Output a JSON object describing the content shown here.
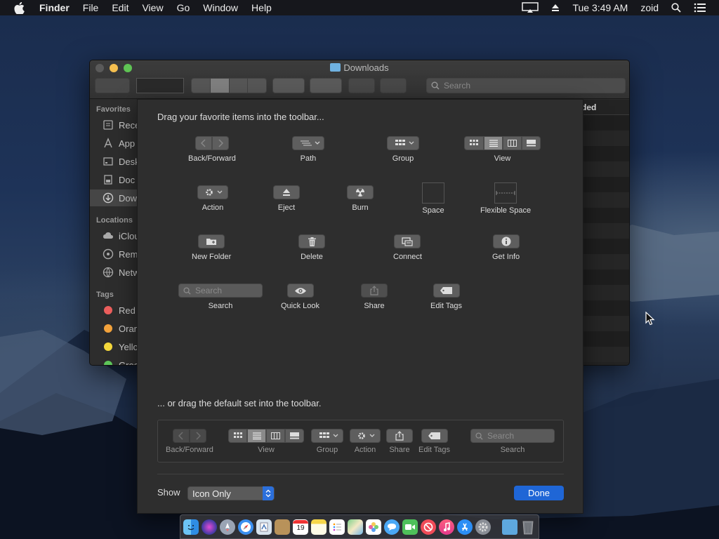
{
  "menubar": {
    "app": "Finder",
    "items": [
      "File",
      "Edit",
      "View",
      "Go",
      "Window",
      "Help"
    ],
    "clock": "Tue 3:49 AM",
    "user": "zoid"
  },
  "window": {
    "title": "Downloads",
    "search_placeholder": "Search",
    "column_header": "ded",
    "sidebar": {
      "favorites_header": "Favorites",
      "favorites": [
        "Rece",
        "App",
        "Desk",
        "Doc",
        "Dow"
      ],
      "locations_header": "Locations",
      "locations": [
        "iClou",
        "Rem",
        "Netw"
      ],
      "tags_header": "Tags",
      "tags": [
        {
          "label": "Red",
          "color": "#ec5f5d"
        },
        {
          "label": "Oran",
          "color": "#f3a33c"
        },
        {
          "label": "Yello",
          "color": "#f5d83c"
        },
        {
          "label": "Gree",
          "color": "#5ec65a"
        }
      ]
    }
  },
  "sheet": {
    "drag_text": "Drag your favorite items into the toolbar...",
    "items": {
      "back_forward": "Back/Forward",
      "path": "Path",
      "group": "Group",
      "view": "View",
      "action": "Action",
      "eject": "Eject",
      "burn": "Burn",
      "space": "Space",
      "flexible_space": "Flexible Space",
      "new_folder": "New Folder",
      "delete": "Delete",
      "connect": "Connect",
      "get_info": "Get Info",
      "search": "Search",
      "search_placeholder": "Search",
      "quick_look": "Quick Look",
      "share": "Share",
      "edit_tags": "Edit Tags"
    },
    "default_text": "... or drag the default set into the toolbar.",
    "default_set": {
      "back_forward": "Back/Forward",
      "view": "View",
      "group": "Group",
      "action": "Action",
      "share": "Share",
      "edit_tags": "Edit Tags",
      "search": "Search",
      "search_placeholder": "Search"
    },
    "show_label": "Show",
    "show_value": "Icon Only",
    "done_label": "Done"
  },
  "dock": {
    "calendar_day": "19"
  },
  "colors": {
    "accent": "#1f66d6",
    "close": "#5a5a5a",
    "minimize": "#f5bf4f",
    "zoom": "#5fc454"
  }
}
